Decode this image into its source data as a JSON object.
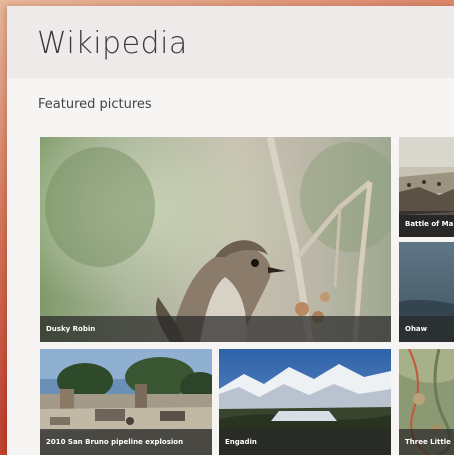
{
  "app": {
    "title": "Wikipedia"
  },
  "section": {
    "title": "Featured pictures"
  },
  "tiles": [
    {
      "caption": "Dusky Robin"
    },
    {
      "caption": "Battle of Ma"
    },
    {
      "caption": "Ohaw"
    },
    {
      "caption": "2010 San Bruno pipeline explosion"
    },
    {
      "caption": "Engadin"
    },
    {
      "caption": "Three Little"
    }
  ],
  "colors": {
    "header_bg": "#efeaea",
    "window_bg": "#f7f4f4",
    "caption_bg": "#282828"
  }
}
